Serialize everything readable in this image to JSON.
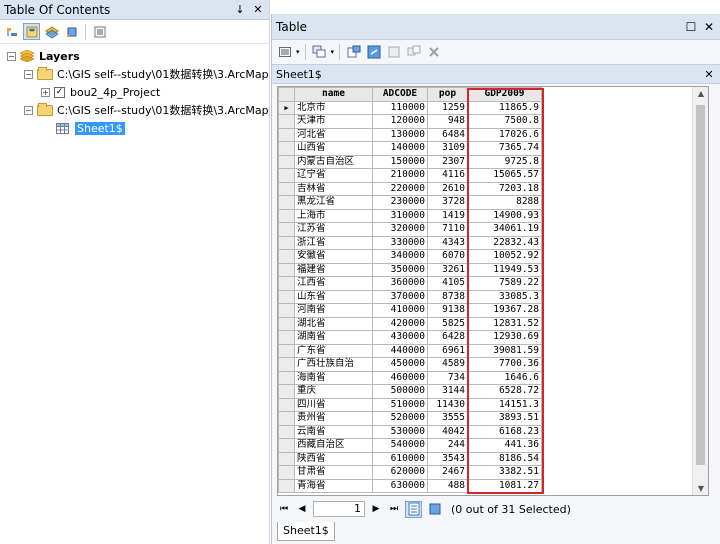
{
  "toc": {
    "title": "Table Of Contents",
    "pin": "↓",
    "close": "✕",
    "toolbar_icons": [
      "list-by-drawing-order-icon",
      "list-by-source-icon",
      "list-by-visibility-icon",
      "list-by-selection-icon",
      "options-icon"
    ],
    "layers_label": "Layers",
    "source1_path": "C:\\GIS  self--study\\01数据转换\\3.ArcMap",
    "layer1_name": "bou2_4p_Project",
    "source2_path": "C:\\GIS  self--study\\01数据转换\\3.ArcMap",
    "table_entry": "Sheet1$"
  },
  "table_window": {
    "title": "Table",
    "tab_title": "Sheet1$",
    "columns": [
      "name",
      "ADCODE",
      "pop",
      "GDP2009"
    ],
    "rows": [
      [
        "北京市",
        "110000",
        "1259",
        "11865.9"
      ],
      [
        "天津市",
        "120000",
        "948",
        "7500.8"
      ],
      [
        "河北省",
        "130000",
        "6484",
        "17026.6"
      ],
      [
        "山西省",
        "140000",
        "3109",
        "7365.74"
      ],
      [
        "内蒙古自治区",
        "150000",
        "2307",
        "9725.8"
      ],
      [
        "辽宁省",
        "210000",
        "4116",
        "15065.57"
      ],
      [
        "吉林省",
        "220000",
        "2610",
        "7203.18"
      ],
      [
        "黑龙江省",
        "230000",
        "3728",
        "8288"
      ],
      [
        "上海市",
        "310000",
        "1419",
        "14900.93"
      ],
      [
        "江苏省",
        "320000",
        "7110",
        "34061.19"
      ],
      [
        "浙江省",
        "330000",
        "4343",
        "22832.43"
      ],
      [
        "安徽省",
        "340000",
        "6070",
        "10052.92"
      ],
      [
        "福建省",
        "350000",
        "3261",
        "11949.53"
      ],
      [
        "江西省",
        "360000",
        "4105",
        "7589.22"
      ],
      [
        "山东省",
        "370000",
        "8738",
        "33085.3"
      ],
      [
        "河南省",
        "410000",
        "9138",
        "19367.28"
      ],
      [
        "湖北省",
        "420000",
        "5825",
        "12831.52"
      ],
      [
        "湖南省",
        "430000",
        "6428",
        "12930.69"
      ],
      [
        "广东省",
        "440000",
        "6961",
        "39081.59"
      ],
      [
        "广西壮族自治",
        "450000",
        "4589",
        "7700.36"
      ],
      [
        "海南省",
        "460000",
        "734",
        "1646.6"
      ],
      [
        "重庆",
        "500000",
        "3144",
        "6528.72"
      ],
      [
        "四川省",
        "510000",
        "11430",
        "14151.3"
      ],
      [
        "贵州省",
        "520000",
        "3555",
        "3893.51"
      ],
      [
        "云南省",
        "530000",
        "4042",
        "6168.23"
      ],
      [
        "西藏自治区",
        "540000",
        "244",
        "441.36"
      ],
      [
        "陕西省",
        "610000",
        "3543",
        "8186.54"
      ],
      [
        "甘肃省",
        "620000",
        "2467",
        "3382.51"
      ],
      [
        "青海省",
        "630000",
        "488",
        "1081.27"
      ]
    ],
    "current_record": "1",
    "selection_status": "(0 out of 31 Selected)",
    "bottom_tab": "Sheet1$"
  }
}
